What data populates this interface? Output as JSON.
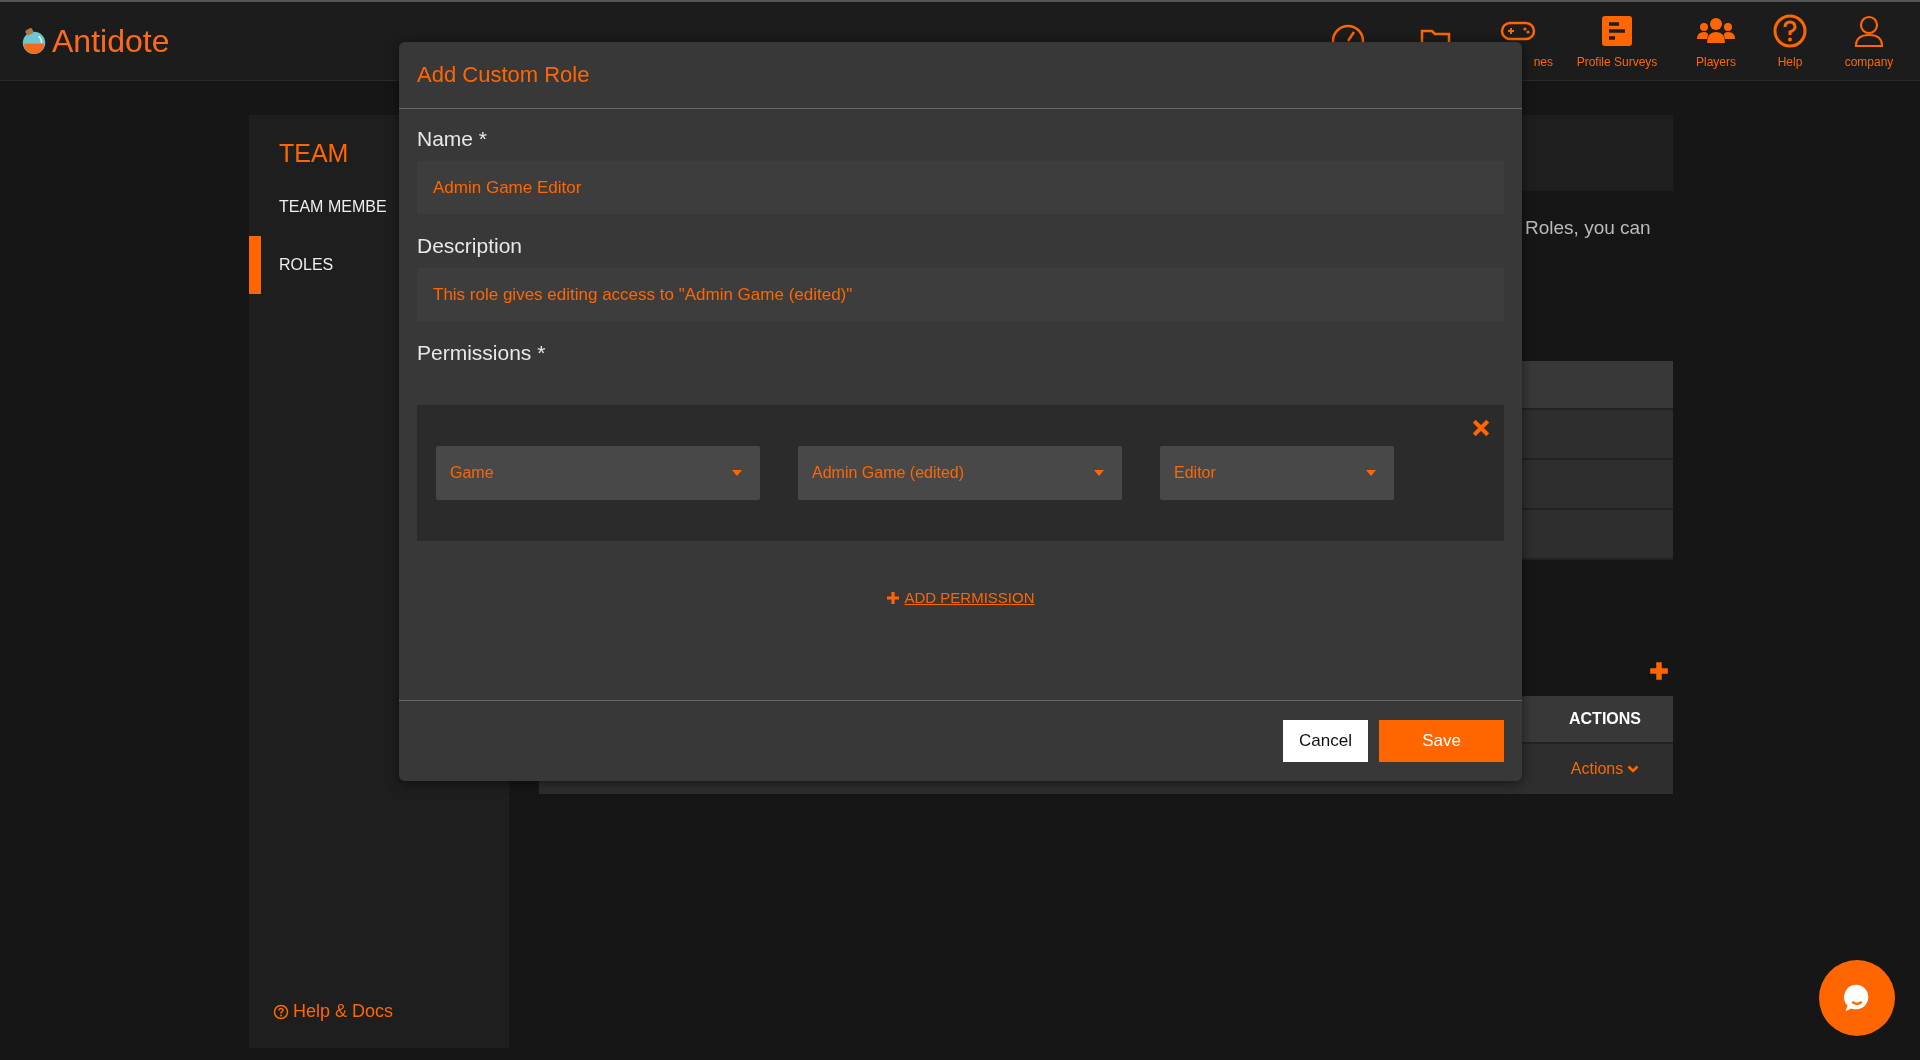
{
  "app": {
    "logo_text": "Antidote"
  },
  "nav": [
    {
      "kind": "gauge"
    },
    {
      "kind": "folder"
    },
    {
      "kind": "gamepad",
      "label": "nes"
    },
    {
      "kind": "survey",
      "label": "Profile Surveys"
    },
    {
      "kind": "players",
      "label": "Players"
    },
    {
      "kind": "help",
      "label": "Help"
    },
    {
      "kind": "user",
      "label": "company"
    }
  ],
  "sidebar": {
    "title": "TEAM",
    "items": [
      {
        "label": "TEAM MEMBE",
        "selected": false
      },
      {
        "label": "ROLES",
        "selected": true
      }
    ],
    "help_link": "Help & Docs"
  },
  "main": {
    "intro_text": "Roles, you can",
    "actions_table": {
      "columns": [
        "ACTIONS"
      ],
      "rows": [
        {
          "actions": "Actions"
        }
      ]
    }
  },
  "dialog": {
    "title": "Add Custom Role",
    "fields": [
      {
        "label": "Name *",
        "value": "Admin Game Editor"
      },
      {
        "label": "Description",
        "value": "This role gives editing access to \"Admin Game (edited)\""
      }
    ],
    "permissions_label": "Permissions *",
    "permissions": [
      {
        "selects": [
          "Game",
          "Admin Game (edited)",
          "Editor"
        ]
      }
    ],
    "add_permission": "ADD PERMISSION",
    "buttons": {
      "cancel": "Cancel",
      "save": "Save"
    }
  }
}
